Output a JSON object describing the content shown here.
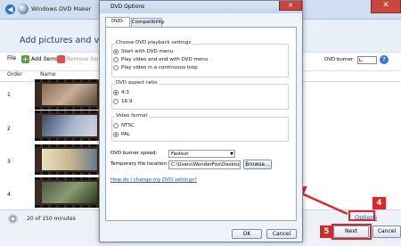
{
  "main_window": {
    "title": "Windows DVD Maker",
    "close_glyph": "✕",
    "back_glyph": "◀",
    "heading": "Add pictures and video to",
    "toolbar": {
      "file_label": "File",
      "add_items_label": "Add items",
      "remove_items_label": "Remove item",
      "dvd_burner_label": "DVD burner:",
      "dvd_burner_value": "L:",
      "help_glyph": "?"
    },
    "columns": {
      "order": "Order",
      "name": "Name"
    },
    "rows": [
      {
        "order": "1"
      },
      {
        "order": "2"
      },
      {
        "order": "3"
      },
      {
        "order": "4"
      }
    ],
    "footer": {
      "minutes": "20 of 150 minutes",
      "options_link": "Options",
      "next_button": "Next",
      "cancel_button": "Cancel"
    }
  },
  "dialog": {
    "title": "DVD Options",
    "close_glyph": "✕",
    "tabs": [
      {
        "label": "DVD-Video",
        "active": true
      },
      {
        "label": "Compatibility",
        "active": false
      }
    ],
    "playback": {
      "group_title": "Choose DVD playback settings",
      "options": [
        {
          "label": "Start with DVD menu",
          "selected": true
        },
        {
          "label": "Play video and end with DVD menu",
          "selected": false
        },
        {
          "label": "Play video in a continuous loop",
          "selected": false
        }
      ]
    },
    "aspect": {
      "group_title": "DVD aspect ratio",
      "options": [
        {
          "label": "4:3",
          "selected": true
        },
        {
          "label": "16:9",
          "selected": false
        }
      ]
    },
    "format": {
      "group_title": "Video format",
      "options": [
        {
          "label": "NTSC",
          "selected": false
        },
        {
          "label": "PAL",
          "selected": true
        }
      ]
    },
    "burner_speed_label": "DVD burner speed:",
    "burner_speed_value": "Fastest",
    "temp_location_label": "Temporary file location:",
    "temp_location_value": "C:\\Users\\WonderFox\\Desktop",
    "browse_button": "Browse...",
    "help_link": "How do I change my DVD settings?",
    "ok_button": "OK",
    "cancel_button": "Cancel"
  },
  "callouts": {
    "step4": "4",
    "step5": "5",
    "color": "#d8282a"
  }
}
